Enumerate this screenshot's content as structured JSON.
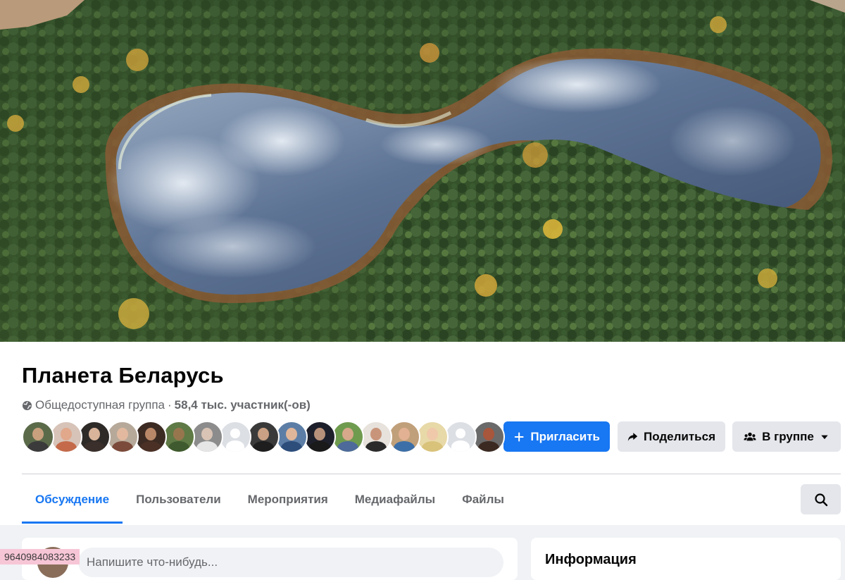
{
  "group": {
    "name": "Планета Беларусь",
    "privacy": "Общедоступная группа",
    "separator": "·",
    "members": "58,4 тыс. участник(-ов)"
  },
  "actions": {
    "invite": "Пригласить",
    "share": "Поделиться",
    "joined": "В группе"
  },
  "tabs": [
    {
      "label": "Обсуждение",
      "active": true
    },
    {
      "label": "Пользователи",
      "active": false
    },
    {
      "label": "Мероприятия",
      "active": false
    },
    {
      "label": "Медиафайлы",
      "active": false
    },
    {
      "label": "Файлы",
      "active": false
    }
  ],
  "member_avatars": [
    {
      "bg": "#5b6b4a",
      "skin": "#c9a07e",
      "shirt": "#3b3b3b"
    },
    {
      "bg": "#d7c3b8",
      "skin": "#e1a88c",
      "shirt": "#c46a4a"
    },
    {
      "bg": "#2e2a28",
      "skin": "#d9b49a",
      "shirt": "#3a2f2a"
    },
    {
      "bg": "#b7a99a",
      "skin": "#e2b99f",
      "shirt": "#7b4a3a"
    },
    {
      "bg": "#3c2b23",
      "skin": "#b98868",
      "shirt": "#4a3025"
    },
    {
      "bg": "#5f7a45",
      "skin": "#97764e",
      "shirt": "#3f5a2e"
    },
    {
      "bg": "#8c8c8c",
      "skin": "#d8c3b5",
      "shirt": "#e6e6e6"
    },
    {
      "placeholder": true
    },
    {
      "bg": "#3a3a3a",
      "skin": "#caa184",
      "shirt": "#1e1e1e"
    },
    {
      "bg": "#5c7ea6",
      "skin": "#e0b69a",
      "shirt": "#2d4d7a"
    },
    {
      "bg": "#1d1f2a",
      "skin": "#b8917a",
      "shirt": "#1a1a1a"
    },
    {
      "bg": "#6f9b4f",
      "skin": "#d7a88a",
      "shirt": "#4d6a9a"
    },
    {
      "bg": "#e7e2dc",
      "skin": "#c9957a",
      "shirt": "#2a2a2a"
    },
    {
      "bg": "#c0a07a",
      "skin": "#e2b193",
      "shirt": "#3c6fa8"
    },
    {
      "bg": "#e8d9a8",
      "skin": "#efc9aa",
      "shirt": "#d9c27a"
    },
    {
      "placeholder": true
    },
    {
      "bg": "#6a6a6a",
      "skin": "#a8563c",
      "shirt": "#3b2a22"
    }
  ],
  "composer": {
    "placeholder": "Напишите что-нибудь..."
  },
  "info": {
    "title": "Информация"
  },
  "id_tag": "9640984083233",
  "colors": {
    "accent": "#1877f2",
    "secondary_button": "#e4e6eb",
    "page_bg": "#f0f2f5",
    "muted_text": "#65676b"
  },
  "icons": {
    "privacy": "globe-icon",
    "invite": "plus-icon",
    "share": "share-arrow-icon",
    "joined": "group-people-icon",
    "dropdown": "caret-down-icon",
    "search": "search-icon"
  }
}
